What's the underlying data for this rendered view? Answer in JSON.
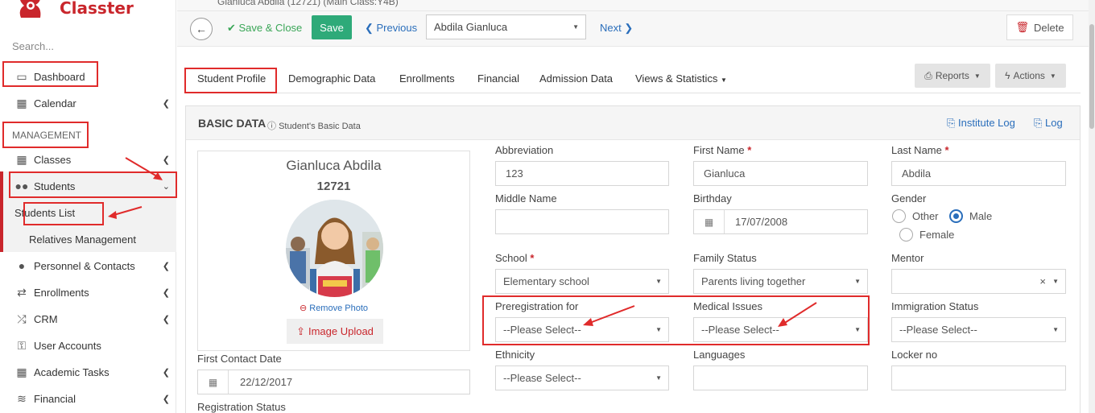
{
  "app": {
    "name": "Classter",
    "brand_color": "#c9262c",
    "accent_color": "#2a6ebb"
  },
  "sidebar": {
    "search_placeholder": "Search...",
    "section_label": "MANAGEMENT",
    "items": [
      {
        "label": "Dashboard",
        "icon": "laptop-icon"
      },
      {
        "label": "Calendar",
        "icon": "calendar-icon"
      },
      {
        "label": "Classes",
        "icon": "classes-icon"
      },
      {
        "label": "Students",
        "icon": "users-icon"
      },
      {
        "label": "Students List"
      },
      {
        "label": "Relatives Management"
      },
      {
        "label": "Personnel & Contacts",
        "icon": "person-icon"
      },
      {
        "label": "Enrollments",
        "icon": "swap-icon"
      },
      {
        "label": "CRM",
        "icon": "shuffle-icon"
      },
      {
        "label": "User Accounts",
        "icon": "key-icon"
      },
      {
        "label": "Academic Tasks",
        "icon": "grid-icon"
      },
      {
        "label": "Financial",
        "icon": "coins-icon"
      }
    ]
  },
  "header": {
    "breadcrumb": "Gianluca Abdila (12721) (Main Class:Y4B)",
    "save_close": "Save & Close",
    "save": "Save",
    "previous": "Previous",
    "student_select": "Abdila Gianluca",
    "next": "Next",
    "delete": "Delete"
  },
  "tabs": {
    "items": [
      "Student Profile",
      "Demographic Data",
      "Enrollments",
      "Financial",
      "Admission Data",
      "Views & Statistics"
    ],
    "reports": "Reports",
    "actions": "Actions"
  },
  "panel": {
    "title": "BASIC DATA",
    "subtitle": "Student's Basic Data",
    "institute_log": "Institute Log",
    "log": "Log"
  },
  "profile": {
    "name": "Gianluca Abdila",
    "id": "12721",
    "remove_photo": "Remove Photo",
    "image_upload": "Image Upload"
  },
  "form": {
    "abbreviation": {
      "label": "Abbreviation",
      "value": "123"
    },
    "first_name": {
      "label": "First Name",
      "value": "Gianluca"
    },
    "last_name": {
      "label": "Last Name",
      "value": "Abdila"
    },
    "middle_name": {
      "label": "Middle Name",
      "value": ""
    },
    "birthday": {
      "label": "Birthday",
      "value": "17/07/2008"
    },
    "gender": {
      "label": "Gender",
      "options": [
        "Other",
        "Male",
        "Female"
      ],
      "selected": "Male"
    },
    "school": {
      "label": "School",
      "value": "Elementary school"
    },
    "family_status": {
      "label": "Family Status",
      "value": "Parents living together"
    },
    "mentor": {
      "label": "Mentor",
      "value": ""
    },
    "preregistration": {
      "label": "Preregistration for",
      "value": "--Please Select--"
    },
    "medical": {
      "label": "Medical Issues",
      "value": "--Please Select--"
    },
    "immigration": {
      "label": "Immigration Status",
      "value": "--Please Select--"
    },
    "ethnicity": {
      "label": "Ethnicity",
      "value": "--Please Select--"
    },
    "languages": {
      "label": "Languages",
      "value": ""
    },
    "locker": {
      "label": "Locker no",
      "value": ""
    },
    "first_contact": {
      "label": "First Contact Date",
      "value": "22/12/2017"
    },
    "registration_status": {
      "label": "Registration Status"
    }
  }
}
